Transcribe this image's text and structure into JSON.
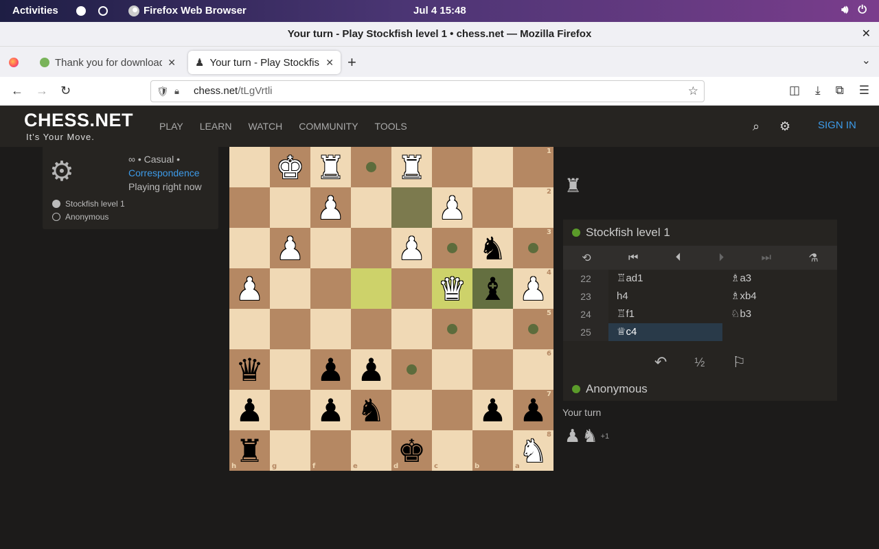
{
  "os": {
    "activities": "Activities",
    "app_name": "Firefox Web Browser",
    "clock": "Jul 4  15:48"
  },
  "browser": {
    "window_title": "Your turn - Play Stockfish level 1 • chess.net — Mozilla Firefox",
    "tabs": [
      {
        "label": "Thank you for downloadin"
      },
      {
        "label": "Your turn - Play Stockfish"
      }
    ],
    "url_host": "chess.net",
    "url_path": "/tLgVrtli"
  },
  "site": {
    "logo": "CHESS.NET",
    "tagline": "It's Your Move.",
    "nav": [
      "PLAY",
      "LEARN",
      "WATCH",
      "COMMUNITY",
      "TOOLS"
    ],
    "signin": "SIGN IN"
  },
  "game_info": {
    "line1": "∞ • Casual •",
    "mode_link": "Correspondence",
    "status": "Playing right now",
    "players": [
      {
        "name": "Stockfish level 1",
        "color": "#bbbbbb"
      },
      {
        "name": "Anonymous",
        "color": ""
      }
    ]
  },
  "board": {
    "orientation": "black",
    "rank_labels": [
      "1",
      "2",
      "3",
      "4",
      "5",
      "6",
      "7",
      "8"
    ],
    "file_labels": [
      "h",
      "g",
      "f",
      "e",
      "d",
      "c",
      "b",
      "a"
    ],
    "rows": [
      [
        "",
        "wK",
        "wR",
        "",
        "wR",
        "",
        "",
        ""
      ],
      [
        "",
        "",
        "wP",
        "",
        "",
        "wP",
        "",
        ""
      ],
      [
        "",
        "wP",
        "",
        "",
        "wP",
        "",
        "bN",
        ""
      ],
      [
        "wP",
        "",
        "",
        "",
        "",
        "wQ",
        "bB",
        "wP"
      ],
      [
        "",
        "",
        "",
        "",
        "",
        "",
        "",
        ""
      ],
      [
        "bQ",
        "",
        "bP",
        "bP",
        "",
        "",
        "",
        ""
      ],
      [
        "bP",
        "",
        "bP",
        "bN",
        "",
        "",
        "bP",
        "bP"
      ],
      [
        "bR",
        "",
        "",
        "",
        "bK",
        "",
        "",
        "wN"
      ]
    ],
    "move_hints": [
      [
        0,
        3
      ],
      [
        2,
        5
      ],
      [
        2,
        7
      ],
      [
        4,
        5
      ],
      [
        4,
        7
      ],
      [
        5,
        4
      ]
    ],
    "highlight": {
      "lastmove_light": [
        3,
        3
      ],
      "lastmove_dark": [
        3,
        5
      ],
      "selected": [
        1,
        4
      ],
      "selected_piece": [
        3,
        6
      ]
    }
  },
  "panel": {
    "captured_top": "♜",
    "top_player": "Stockfish level 1",
    "top_player_dot": "#5b9b2a",
    "moves": [
      {
        "num": "22",
        "white": "♖ad1",
        "black": "♗a3"
      },
      {
        "num": "23",
        "white": "h4",
        "black": "♗xb4"
      },
      {
        "num": "24",
        "white": "♖f1",
        "black": "♘b3"
      },
      {
        "num": "25",
        "white": "♕c4",
        "black": ""
      }
    ],
    "draw_label": "½",
    "bottom_player": "Anonymous",
    "bottom_player_dot": "#5b9b2a",
    "your_turn": "Your turn",
    "captured_bottom": [
      "♟",
      "♞"
    ],
    "captured_bottom_plus": "+1"
  }
}
